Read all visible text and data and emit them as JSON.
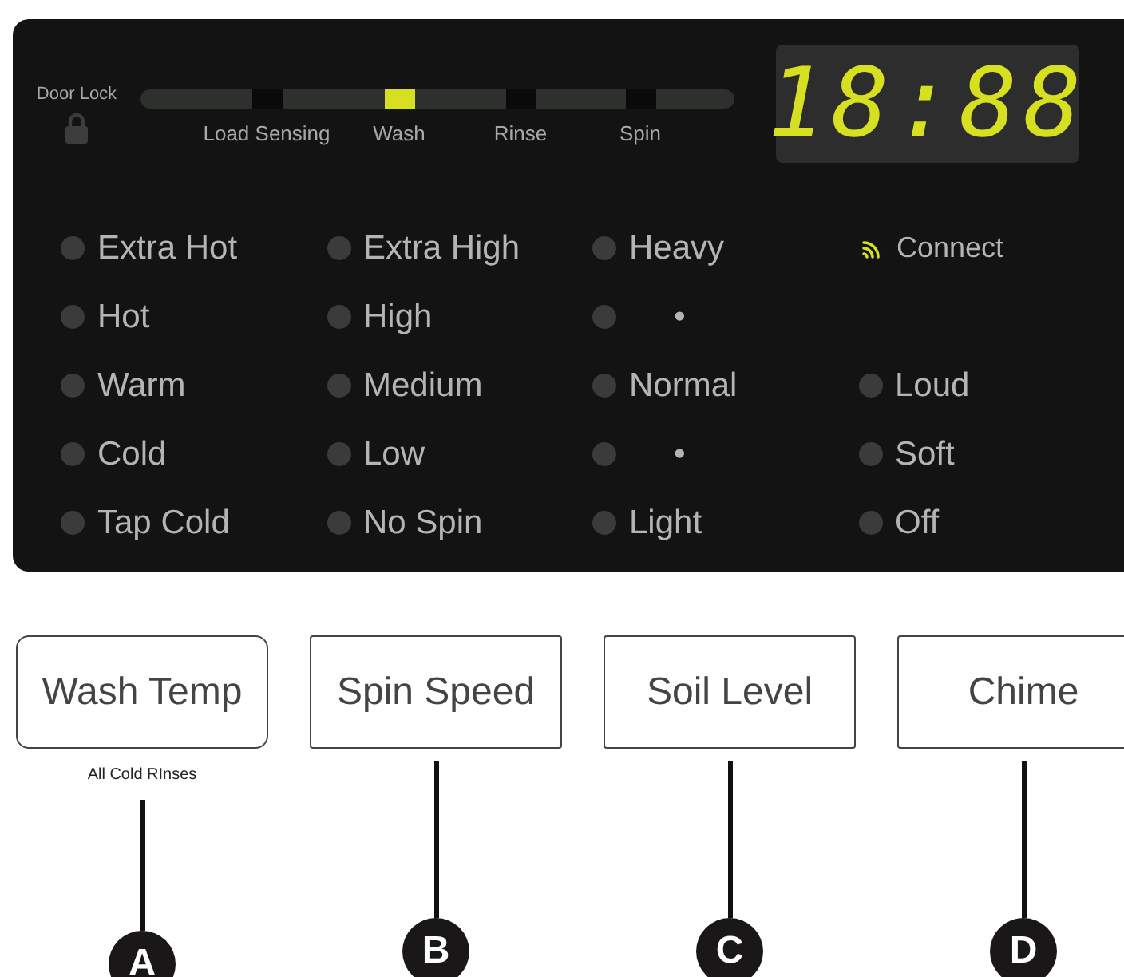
{
  "door_lock": {
    "label": "Door Lock"
  },
  "progress": {
    "stages": [
      {
        "label": "Load Sensing",
        "selected": false
      },
      {
        "label": "Wash",
        "selected": true
      },
      {
        "label": "Rinse",
        "selected": false
      },
      {
        "label": "Spin",
        "selected": false
      }
    ]
  },
  "display": {
    "time": "18:88"
  },
  "option_columns": [
    {
      "items": [
        {
          "kind": "option",
          "label": "Extra Hot"
        },
        {
          "kind": "option",
          "label": "Hot"
        },
        {
          "kind": "option",
          "label": "Warm"
        },
        {
          "kind": "option",
          "label": "Cold"
        },
        {
          "kind": "option",
          "label": "Tap Cold"
        }
      ]
    },
    {
      "items": [
        {
          "kind": "option",
          "label": "Extra High"
        },
        {
          "kind": "option",
          "label": "High"
        },
        {
          "kind": "option",
          "label": "Medium"
        },
        {
          "kind": "option",
          "label": "Low"
        },
        {
          "kind": "option",
          "label": "No Spin"
        }
      ]
    },
    {
      "items": [
        {
          "kind": "option",
          "label": "Heavy"
        },
        {
          "kind": "option",
          "label": "•"
        },
        {
          "kind": "option",
          "label": "Normal"
        },
        {
          "kind": "option",
          "label": "•"
        },
        {
          "kind": "option",
          "label": "Light"
        }
      ]
    },
    {
      "items": [
        {
          "kind": "wifi",
          "label": "Connect"
        },
        {
          "kind": "blank"
        },
        {
          "kind": "option",
          "label": "Loud"
        },
        {
          "kind": "option",
          "label": "Soft"
        },
        {
          "kind": "option",
          "label": "Off"
        }
      ]
    }
  ],
  "buttons": [
    {
      "label": "Wash Temp",
      "caption": "All Cold RInses",
      "callout": "A"
    },
    {
      "label": "Spin Speed",
      "callout": "B"
    },
    {
      "label": "Soil Level",
      "callout": "C"
    },
    {
      "label": "Chime",
      "callout": "D"
    }
  ]
}
